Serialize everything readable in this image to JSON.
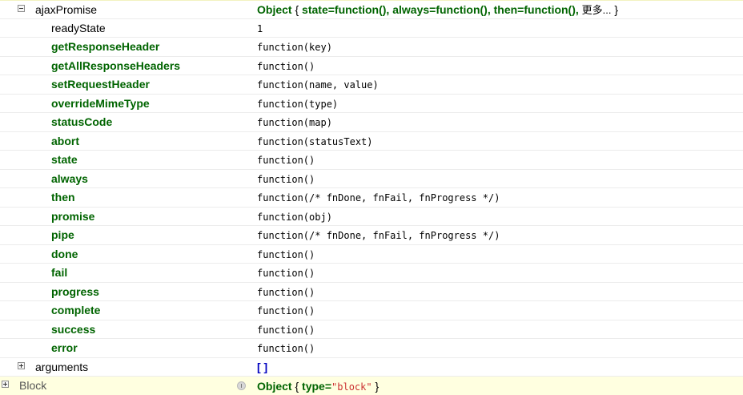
{
  "root": {
    "name": "ajaxPromise",
    "object_label": "Object",
    "open_brace": "{",
    "summary": "state=function(),   always=function(),   then=function(),",
    "more_label": "更多...",
    "close_brace": "}"
  },
  "props": [
    {
      "name": "readyState",
      "value": "1",
      "bold": false
    },
    {
      "name": "getResponseHeader",
      "value": "function(key)",
      "bold": true
    },
    {
      "name": "getAllResponseHeaders",
      "value": "function()",
      "bold": true
    },
    {
      "name": "setRequestHeader",
      "value": "function(name, value)",
      "bold": true
    },
    {
      "name": "overrideMimeType",
      "value": "function(type)",
      "bold": true
    },
    {
      "name": "statusCode",
      "value": "function(map)",
      "bold": true
    },
    {
      "name": "abort",
      "value": "function(statusText)",
      "bold": true
    },
    {
      "name": "state",
      "value": "function()",
      "bold": true
    },
    {
      "name": "always",
      "value": "function()",
      "bold": true
    },
    {
      "name": "then",
      "value": "function(/* fnDone, fnFail, fnProgress */)",
      "bold": true
    },
    {
      "name": "promise",
      "value": "function(obj)",
      "bold": true
    },
    {
      "name": "pipe",
      "value": "function(/* fnDone, fnFail, fnProgress */)",
      "bold": true
    },
    {
      "name": "done",
      "value": "function()",
      "bold": true
    },
    {
      "name": "fail",
      "value": "function()",
      "bold": true
    },
    {
      "name": "progress",
      "value": "function()",
      "bold": true
    },
    {
      "name": "complete",
      "value": "function()",
      "bold": true
    },
    {
      "name": "success",
      "value": "function()",
      "bold": true
    },
    {
      "name": "error",
      "value": "function()",
      "bold": true
    }
  ],
  "arguments_row": {
    "name": "arguments",
    "value": "[ ]"
  },
  "block_row": {
    "name": "Block",
    "object_label": "Object",
    "open_brace": "{",
    "key": "type=",
    "string_value": "\"block\"",
    "close_brace": "}"
  },
  "colors": {
    "property_green": "#006400",
    "array_blue": "#0000c0",
    "string_red": "#cc3333",
    "highlight_row": "#ffffe0"
  },
  "icons": {
    "expanded": "collapse-minus-icon",
    "collapsed": "expand-plus-icon",
    "info": "info-icon"
  }
}
